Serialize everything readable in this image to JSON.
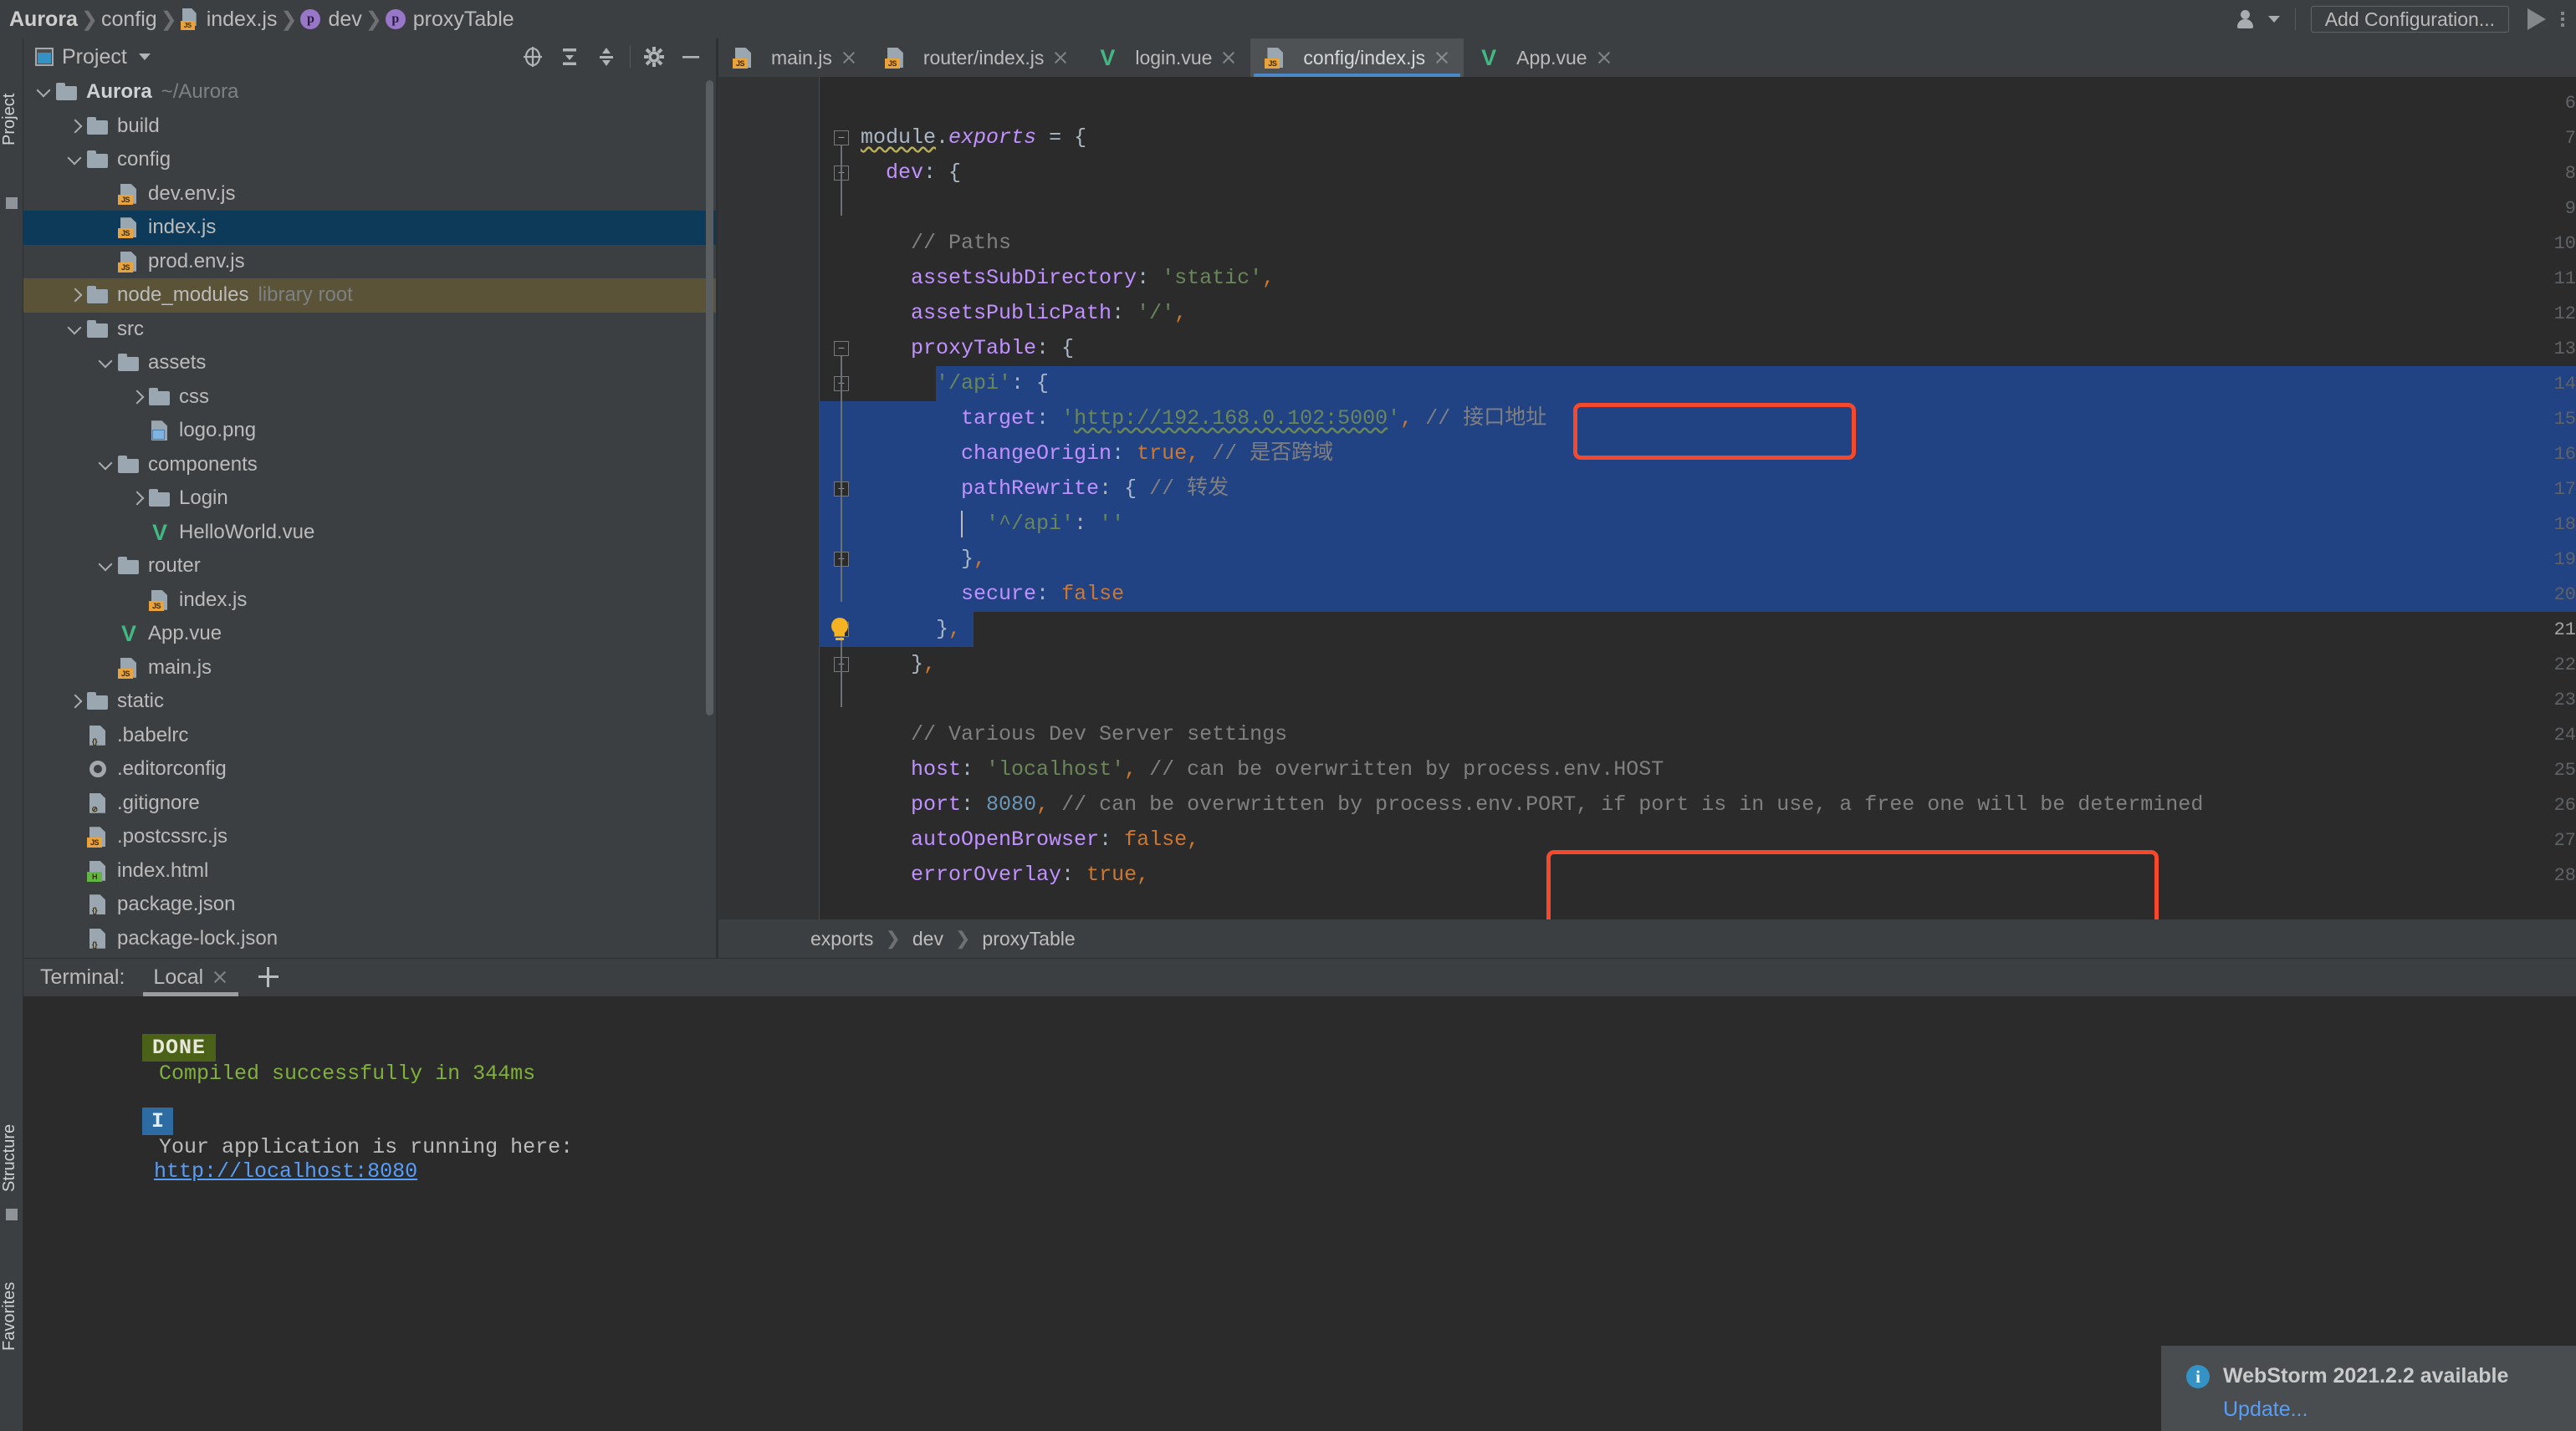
{
  "navbar": {
    "crumbs": [
      {
        "label": "Aurora",
        "icon": "none",
        "bold": true
      },
      {
        "label": "config",
        "icon": "none",
        "bold": false
      },
      {
        "label": "index.js",
        "icon": "js-file-icon",
        "bold": false
      },
      {
        "label": "dev",
        "icon": "property-icon",
        "bold": false
      },
      {
        "label": "proxyTable",
        "icon": "property-icon",
        "bold": false
      }
    ],
    "separator": "❯",
    "user_icon": "user-account-icon",
    "add_configuration": "Add Configuration...",
    "run_icon": "run-play-icon",
    "more_icon": "more-options-icon"
  },
  "left_strip": {
    "project_label": "Project",
    "structure_label": "Structure",
    "favorites_label": "Favorites"
  },
  "project_panel": {
    "title": "Project",
    "tools": [
      {
        "name": "locate-icon",
        "glyph": "target"
      },
      {
        "name": "expand-all-icon",
        "glyph": "expand"
      },
      {
        "name": "collapse-all-icon",
        "glyph": "collapse"
      },
      {
        "name": "settings-gear-icon",
        "glyph": "gear"
      },
      {
        "name": "hide-panel-icon",
        "glyph": "minus"
      }
    ],
    "tree": [
      {
        "indent": 0,
        "chev": "down",
        "icon": "folder",
        "label": "Aurora",
        "bold": true,
        "sub": "~/Aurora",
        "state": "normal"
      },
      {
        "indent": 1,
        "chev": "right",
        "icon": "folder",
        "label": "build",
        "bold": false,
        "sub": "",
        "state": "normal"
      },
      {
        "indent": 1,
        "chev": "down",
        "icon": "folder",
        "label": "config",
        "bold": false,
        "sub": "",
        "state": "normal"
      },
      {
        "indent": 2,
        "chev": "none",
        "icon": "js",
        "label": "dev.env.js",
        "bold": false,
        "sub": "",
        "state": "normal"
      },
      {
        "indent": 2,
        "chev": "none",
        "icon": "js",
        "label": "index.js",
        "bold": false,
        "sub": "",
        "state": "selected"
      },
      {
        "indent": 2,
        "chev": "none",
        "icon": "js",
        "label": "prod.env.js",
        "bold": false,
        "sub": "",
        "state": "normal"
      },
      {
        "indent": 1,
        "chev": "right",
        "icon": "folder",
        "label": "node_modules",
        "bold": false,
        "sub": "library root",
        "state": "libroot"
      },
      {
        "indent": 1,
        "chev": "down",
        "icon": "folder",
        "label": "src",
        "bold": false,
        "sub": "",
        "state": "normal"
      },
      {
        "indent": 2,
        "chev": "down",
        "icon": "folder",
        "label": "assets",
        "bold": false,
        "sub": "",
        "state": "normal"
      },
      {
        "indent": 3,
        "chev": "right",
        "icon": "folder",
        "label": "css",
        "bold": false,
        "sub": "",
        "state": "normal"
      },
      {
        "indent": 3,
        "chev": "none",
        "icon": "img",
        "label": "logo.png",
        "bold": false,
        "sub": "",
        "state": "normal"
      },
      {
        "indent": 2,
        "chev": "down",
        "icon": "folder",
        "label": "components",
        "bold": false,
        "sub": "",
        "state": "normal"
      },
      {
        "indent": 3,
        "chev": "right",
        "icon": "folder",
        "label": "Login",
        "bold": false,
        "sub": "",
        "state": "normal"
      },
      {
        "indent": 3,
        "chev": "none",
        "icon": "vue",
        "label": "HelloWorld.vue",
        "bold": false,
        "sub": "",
        "state": "normal"
      },
      {
        "indent": 2,
        "chev": "down",
        "icon": "folder",
        "label": "router",
        "bold": false,
        "sub": "",
        "state": "normal"
      },
      {
        "indent": 3,
        "chev": "none",
        "icon": "js",
        "label": "index.js",
        "bold": false,
        "sub": "",
        "state": "normal"
      },
      {
        "indent": 2,
        "chev": "none",
        "icon": "vue",
        "label": "App.vue",
        "bold": false,
        "sub": "",
        "state": "normal"
      },
      {
        "indent": 2,
        "chev": "none",
        "icon": "js",
        "label": "main.js",
        "bold": false,
        "sub": "",
        "state": "normal"
      },
      {
        "indent": 1,
        "chev": "right",
        "icon": "folder",
        "label": "static",
        "bold": false,
        "sub": "",
        "state": "normal"
      },
      {
        "indent": 1,
        "chev": "none",
        "icon": "json",
        "label": ".babelrc",
        "bold": false,
        "sub": "",
        "state": "normal"
      },
      {
        "indent": 1,
        "chev": "none",
        "icon": "gear",
        "label": ".editorconfig",
        "bold": false,
        "sub": "",
        "state": "normal"
      },
      {
        "indent": 1,
        "chev": "none",
        "icon": "ignore",
        "label": ".gitignore",
        "bold": false,
        "sub": "",
        "state": "normal"
      },
      {
        "indent": 1,
        "chev": "none",
        "icon": "js",
        "label": ".postcssrc.js",
        "bold": false,
        "sub": "",
        "state": "normal"
      },
      {
        "indent": 1,
        "chev": "none",
        "icon": "html",
        "label": "index.html",
        "bold": false,
        "sub": "",
        "state": "normal"
      },
      {
        "indent": 1,
        "chev": "none",
        "icon": "json",
        "label": "package.json",
        "bold": false,
        "sub": "",
        "state": "normal"
      },
      {
        "indent": 1,
        "chev": "none",
        "icon": "json",
        "label": "package-lock.json",
        "bold": false,
        "sub": "",
        "state": "normal"
      }
    ]
  },
  "editor": {
    "tabs": [
      {
        "label": "main.js",
        "icon": "js",
        "active": false
      },
      {
        "label": "router/index.js",
        "icon": "js",
        "active": false
      },
      {
        "label": "login.vue",
        "icon": "vue",
        "active": false
      },
      {
        "label": "config/index.js",
        "icon": "js",
        "active": true
      },
      {
        "label": "App.vue",
        "icon": "vue",
        "active": false
      }
    ],
    "line_numbers": [
      "6",
      "7",
      "8",
      "9",
      "10",
      "11",
      "12",
      "13",
      "14",
      "15",
      "16",
      "17",
      "18",
      "19",
      "20",
      "21",
      "22",
      "23",
      "24",
      "25",
      "26",
      "27",
      "28"
    ],
    "current_line": "21",
    "code_lines": [
      "",
      "module.exports = {",
      "  dev: {",
      "",
      "    // Paths",
      "    assetsSubDirectory: 'static',",
      "    assetsPublicPath: '/',",
      "    proxyTable: {",
      "      '/api': {",
      "        target: 'http://192.168.0.102:5000', // 接口地址",
      "        changeOrigin: true, // 是否跨域",
      "        pathRewrite: { // 转发",
      "          '^/api': ''",
      "        },",
      "        secure: false",
      "      },",
      "    },",
      "",
      "    // Various Dev Server settings",
      "    host: 'localhost', // can be overwritten by process.env.HOST",
      "    port: 8080, // can be overwritten by process.env.PORT, if port is in use, a free one will be determined",
      "    autoOpenBrowser: false,",
      "    errorOverlay: true,"
    ],
    "breadcrumb": [
      "exports",
      "dev",
      "proxyTable"
    ],
    "breadcrumb_separator": "❯",
    "annotations": [
      {
        "name": "proxyTable-highlight-box",
        "color": "#f4492d"
      },
      {
        "name": "host-port-highlight-box",
        "color": "#f4492d"
      }
    ],
    "selection_color": "#214283"
  },
  "terminal": {
    "title": "Terminal:",
    "tab_label": "Local",
    "add_tab_icon": "plus-icon",
    "done_badge": "DONE",
    "compiled_message": "Compiled successfully in 344ms",
    "info_badge": "I",
    "running_message": "Your application is running here:",
    "running_url": "http://localhost:8080"
  },
  "notification": {
    "icon": "info-icon",
    "title": "WebStorm 2021.2.2 available",
    "action": "Update..."
  }
}
